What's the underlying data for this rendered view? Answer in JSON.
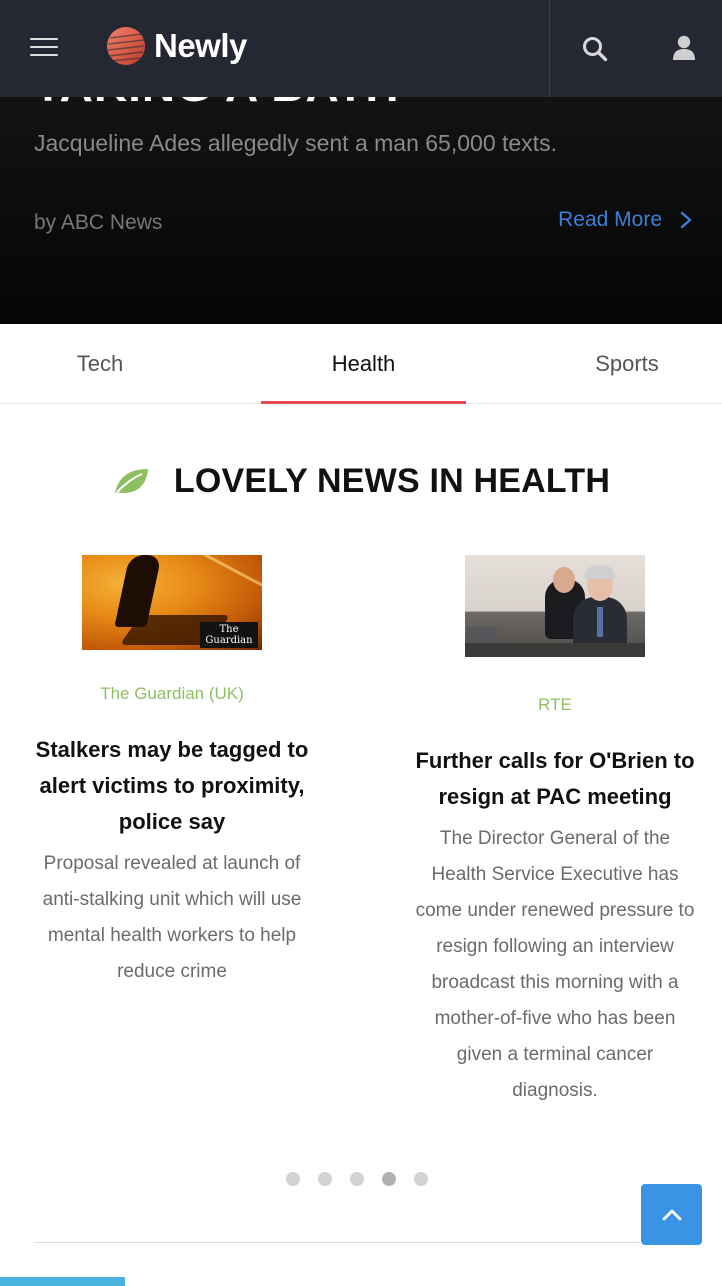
{
  "header": {
    "brand": "Newly",
    "colors": {
      "background": "#252833",
      "logo_gradient": [
        "#f2836b",
        "#c0392b"
      ]
    },
    "icons": {
      "menu": "hamburger-icon",
      "search": "search-icon",
      "user": "user-icon"
    }
  },
  "hero": {
    "title": "TAKING A BATH",
    "subtitle": "Jacqueline Ades allegedly sent a man 65,000 texts.",
    "author": "by ABC News",
    "read_more": "Read More"
  },
  "tabs": [
    {
      "label": "Tech",
      "active": false
    },
    {
      "label": "Health",
      "active": true
    },
    {
      "label": "Sports",
      "active": false
    }
  ],
  "section": {
    "title": "LOVELY NEWS IN HEALTH",
    "icon": "leaf-icon",
    "accent": "#8dc063"
  },
  "cards": [
    {
      "source": "The Guardian (UK)",
      "headline": "Stalkers may be tagged to alert victims to proximity, police say",
      "summary": "Proposal revealed at launch of anti-stalking unit which will use mental health workers to help reduce crime",
      "thumb_badge": "The Guardian"
    },
    {
      "source": "RTE",
      "headline": "Further calls for O'Brien to resign at PAC meeting",
      "summary": "The Director General of the Health Service Executive has come under renewed pressure to resign following an interview broadcast this morning with a mother-of-five who has been given a terminal cancer diagnosis."
    }
  ],
  "pagination": {
    "total": 5,
    "active_index": 3
  },
  "scroll_top": {
    "icon": "chevron-up-icon",
    "color": "#3a94e6"
  }
}
